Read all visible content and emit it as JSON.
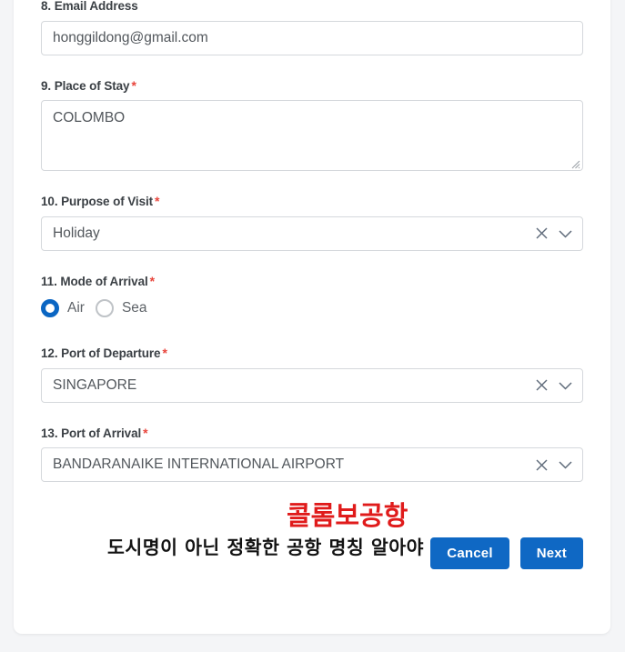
{
  "form": {
    "fields": [
      {
        "label": "8. Email Address",
        "required": false,
        "type": "text",
        "value": "honggildong@gmail.com"
      },
      {
        "label": "9. Place of Stay",
        "required": true,
        "type": "textarea",
        "value": "COLOMBO"
      },
      {
        "label": "10. Purpose of Visit",
        "required": true,
        "type": "select",
        "value": "Holiday"
      },
      {
        "label": "11. Mode of Arrival",
        "required": true,
        "type": "radio",
        "options": [
          {
            "label": "Air",
            "selected": true
          },
          {
            "label": "Sea",
            "selected": false
          }
        ]
      },
      {
        "label": "12. Port of Departure",
        "required": true,
        "type": "select",
        "value": "SINGAPORE"
      },
      {
        "label": "13. Port of Arrival",
        "required": true,
        "type": "select",
        "value": "BANDARANAIKE INTERNATIONAL AIRPORT"
      }
    ],
    "required_marker": "*"
  },
  "icons": {
    "clear": "clear-icon",
    "dropdown": "chevron-down-icon",
    "resize": "resize-grip-icon"
  },
  "annotations": {
    "red_text": "콜롬보공항",
    "black_text": "도시명이 아닌 정확한 공항 명칭 알아야",
    "red_color": "#e01b1b",
    "black_color": "#121212"
  },
  "buttons": {
    "cancel": "Cancel",
    "next": "Next",
    "color": "#0f68c4"
  }
}
